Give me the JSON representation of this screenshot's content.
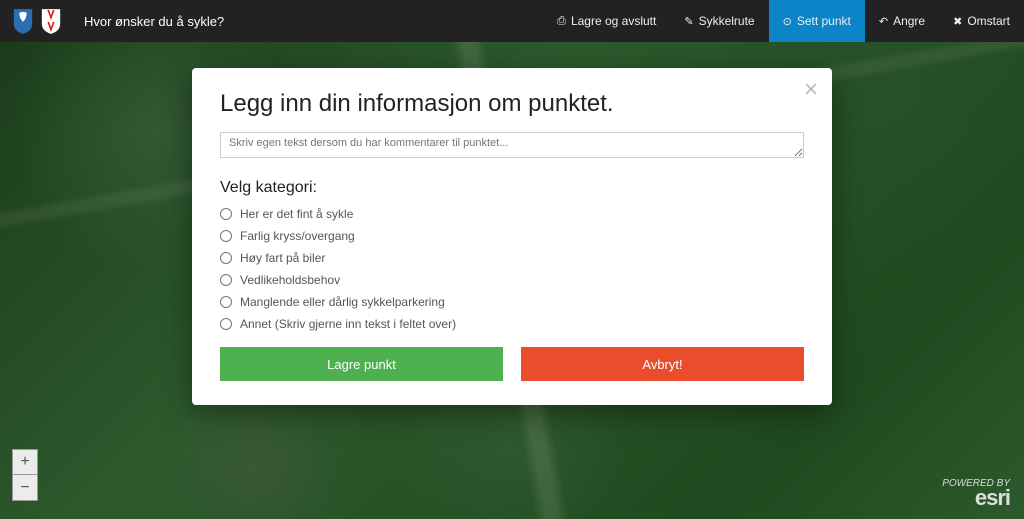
{
  "header": {
    "title": "Hvor ønsker du å sykle?",
    "nav": {
      "save_exit": "Lagre og avslutt",
      "route": "Sykkelrute",
      "set_point": "Sett punkt",
      "undo": "Angre",
      "restart": "Omstart"
    }
  },
  "zoom": {
    "in": "+",
    "out": "−"
  },
  "attribution": {
    "powered_by": "POWERED BY",
    "brand": "esri"
  },
  "modal": {
    "title": "Legg inn din informasjon om punktet.",
    "textarea_placeholder": "Skriv egen tekst dersom du har kommentarer til punktet...",
    "subhead": "Velg kategori:",
    "categories": [
      "Her er det fint å sykle",
      "Farlig kryss/overgang",
      "Høy fart på biler",
      "Vedlikeholdsbehov",
      "Manglende eller dårlig sykkelparkering",
      "Annet (Skriv gjerne inn tekst i feltet over)"
    ],
    "save_label": "Lagre punkt",
    "cancel_label": "Avbryt!"
  }
}
